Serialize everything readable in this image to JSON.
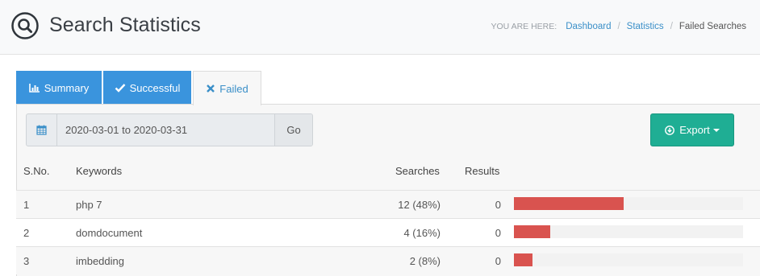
{
  "header": {
    "title": "Search Statistics",
    "title_icon": "search-icon",
    "breadcrumb": {
      "lead": "YOU ARE HERE:",
      "items": [
        "Dashboard",
        "Statistics",
        "Failed Searches"
      ],
      "separator": "/"
    }
  },
  "tabs": [
    {
      "label": "Summary",
      "icon": "bar-chart-icon",
      "active": false
    },
    {
      "label": "Successful",
      "icon": "check-icon",
      "active": false
    },
    {
      "label": "Failed",
      "icon": "close-icon",
      "active": true
    }
  ],
  "filter": {
    "date_icon": "calendar-icon",
    "date_range": "2020-03-01 to 2020-03-31",
    "go_label": "Go"
  },
  "export": {
    "label": "Export",
    "icon": "download-circle-icon"
  },
  "table": {
    "columns": [
      "S.No.",
      "Keywords",
      "Searches",
      "Results"
    ],
    "rows": [
      {
        "sno": "1",
        "keyword": "php 7",
        "searches": "12 (48%)",
        "results": "0",
        "share": 0.48
      },
      {
        "sno": "2",
        "keyword": "domdocument",
        "searches": "4 (16%)",
        "results": "0",
        "share": 0.16
      },
      {
        "sno": "3",
        "keyword": "imbedding",
        "searches": "2 (8%)",
        "results": "0",
        "share": 0.08
      }
    ]
  },
  "colors": {
    "tab_blue": "#3a94dd",
    "export_green": "#1fae94",
    "bar_red": "#d9534f",
    "link_blue": "#3a8fc8"
  }
}
